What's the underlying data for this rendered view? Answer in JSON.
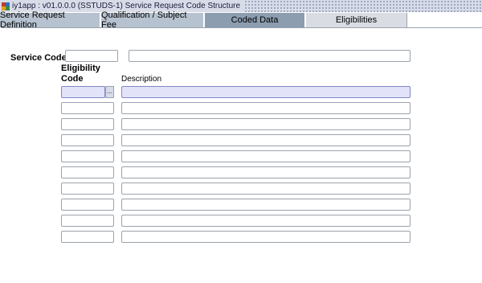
{
  "window": {
    "title": "iy1app : v01.0.0.0 (SSTUDS-1) Service Request Code Structure"
  },
  "tabs": [
    {
      "label": "Service Request Definition"
    },
    {
      "label": "Qualification / Subject Fee"
    },
    {
      "label": "Coded Data"
    },
    {
      "label": "Eligibilities"
    }
  ],
  "active_tab": "Eligibilities",
  "form": {
    "service_code_label": "Service Code",
    "service_code_value": "",
    "service_description_value": "",
    "columns": {
      "eligibility_code_line1": "Eligibility",
      "eligibility_code_line2": "Code",
      "description": "Description"
    },
    "lov_button_label": "...",
    "rows": [
      {
        "code": "",
        "description": ""
      },
      {
        "code": "",
        "description": ""
      },
      {
        "code": "",
        "description": ""
      },
      {
        "code": "",
        "description": ""
      },
      {
        "code": "",
        "description": ""
      },
      {
        "code": "",
        "description": ""
      },
      {
        "code": "",
        "description": ""
      },
      {
        "code": "",
        "description": ""
      },
      {
        "code": "",
        "description": ""
      },
      {
        "code": "",
        "description": ""
      }
    ]
  },
  "colors": {
    "active_field": "#e2e2f8",
    "tab_inactive": "#b7c2d0",
    "tab_coded_data": "#8c9db0",
    "tab_active": "#d9dde3",
    "field_border": "#9aa3ad"
  }
}
